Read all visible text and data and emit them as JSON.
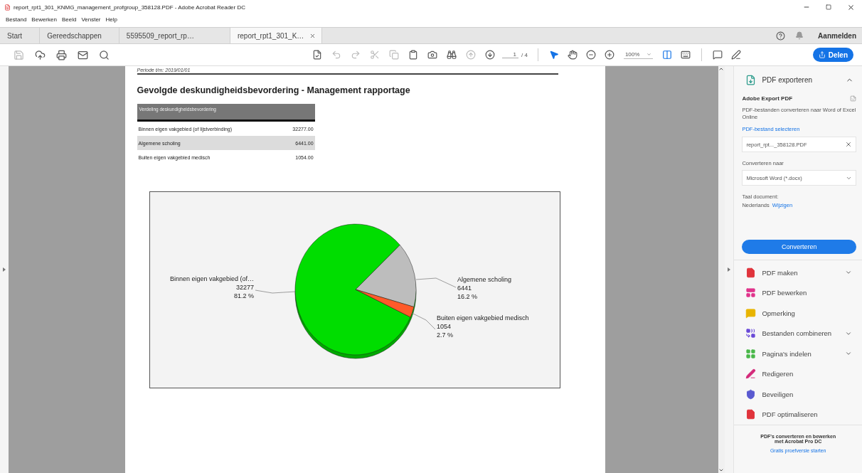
{
  "window": {
    "title": "report_rpt1_301_KNMG_management_profgroup_358128.PDF - Adobe Acrobat Reader DC"
  },
  "menu": [
    "Bestand",
    "Bewerken",
    "Beeld",
    "Venster",
    "Help"
  ],
  "tabs": [
    {
      "label": "Start",
      "selected": false,
      "closable": false
    },
    {
      "label": "Gereedschappen",
      "selected": false,
      "closable": false
    },
    {
      "label": "5595509_report_rp…",
      "selected": false,
      "closable": false
    },
    {
      "label": "report_rpt1_301_K…",
      "selected": true,
      "closable": true
    }
  ],
  "account": {
    "label": "Aanmelden"
  },
  "toolbar": {
    "left": [
      {
        "disabled": true
      },
      {
        "disabled": false
      },
      {
        "disabled": false
      },
      {
        "disabled": false
      },
      {
        "disabled": false
      }
    ],
    "middle": [
      {
        "disabled": false
      },
      {
        "disabled": true
      },
      {
        "disabled": true
      },
      {
        "disabled": true
      },
      {
        "disabled": true
      },
      {
        "disabled": false
      },
      {
        "disabled": false
      },
      {
        "disabled": false
      },
      {
        "disabled": true
      },
      {
        "disabled": false
      }
    ],
    "page": "1",
    "page_total": "/ 4",
    "zoom": "100%",
    "share": "Delen"
  },
  "document": {
    "period": "Periode t/m: 2019/01/01",
    "title": "Gevolgde deskundigheidsbevordering - Management rapportage",
    "table": {
      "header": "Verdeling deskundigheidsbevordering",
      "rows": [
        {
          "label": "Binnen eigen vakgebied (of lijstverbinding)",
          "value": "32277.00",
          "shaded": false
        },
        {
          "label": "Algemene scholing",
          "value": "6441.00",
          "shaded": true
        },
        {
          "label": "Buiten eigen vakgebied medisch",
          "value": "1054.00",
          "shaded": false
        }
      ]
    },
    "chart": {
      "chart_data": {
        "type": "pie",
        "categories": [
          "Binnen eigen vakgebied (of…",
          "Algemene scholing",
          "Buiten eigen vakgebied medisch"
        ],
        "values": [
          32277,
          6441,
          1054
        ],
        "data_labels": true
      },
      "slices": [
        {
          "percent": "81.2 %",
          "color": "#00dd00"
        },
        {
          "percent": "16.2 %",
          "color": "#bdbdbd"
        },
        {
          "percent": "2.7 %",
          "color": "#ff5a2a"
        }
      ]
    }
  },
  "panel": {
    "export": {
      "title": "PDF exporteren",
      "heading": "Adobe Export PDF",
      "description": "PDF-bestanden converteren naar Word of Excel Online",
      "select_link": "PDF-bestand selecteren",
      "file": "report_rpt..._358128.PDF",
      "convert_label": "Converteren naar",
      "format": "Microsoft Word (*.docx)",
      "language_label": "Taal document:",
      "language": "Nederlands",
      "change_link": "Wijzigen",
      "button": "Converteren"
    },
    "tools": [
      {
        "label": "PDF maken",
        "expandable": true,
        "color": "#e0343c"
      },
      {
        "label": "PDF bewerken",
        "expandable": false,
        "color": "#e0348c"
      },
      {
        "label": "Opmerking",
        "expandable": false,
        "color": "#e8b400"
      },
      {
        "label": "Bestanden combineren",
        "expandable": true,
        "color": "#6a4ad8"
      },
      {
        "label": "Pagina's indelen",
        "expandable": true,
        "color": "#4ab84a"
      },
      {
        "label": "Redigeren",
        "expandable": false,
        "color": "#d42a7a"
      },
      {
        "label": "Beveiligen",
        "expandable": false,
        "color": "#5a5ad0"
      },
      {
        "label": "PDF optimaliseren",
        "expandable": false,
        "color": "#e0343c"
      }
    ],
    "promo": {
      "text": "PDF's converteren en bewerken met Acrobat Pro DC",
      "link": "Gratis proefversie starten"
    }
  }
}
